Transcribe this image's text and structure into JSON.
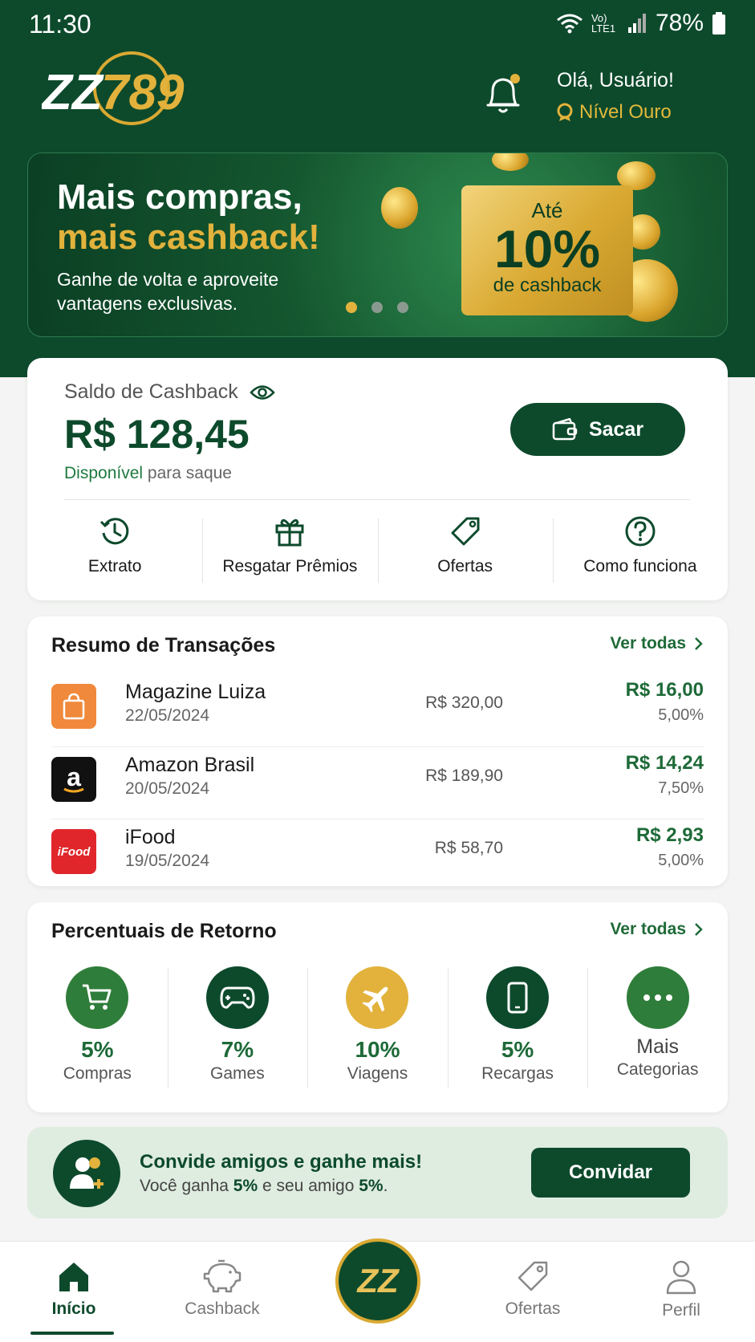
{
  "status": {
    "time": "11:30",
    "network": "Vo) LTE1",
    "battery": "78%"
  },
  "header": {
    "logo": "ZZ789",
    "greeting": "Olá, Usuário!",
    "level": "Nível Ouro"
  },
  "banner": {
    "title_line1": "Mais compras,",
    "title_line2": "mais cashback!",
    "subtitle": "Ganhe de volta e aproveite vantagens exclusivas.",
    "badge_top": "Até",
    "badge_value": "10%",
    "badge_bottom": "de cashback",
    "slides": 3,
    "active_slide": 1
  },
  "balance": {
    "label": "Saldo de Cashback",
    "value": "R$ 128,45",
    "available_word": "Disponível",
    "available_rest": "para saque",
    "withdraw_label": "Sacar",
    "actions": [
      {
        "label": "Extrato",
        "icon": "history-icon"
      },
      {
        "label": "Resgatar Prêmios",
        "icon": "gift-icon"
      },
      {
        "label": "Ofertas",
        "icon": "tag-icon"
      },
      {
        "label": "Como funciona",
        "icon": "help-icon"
      }
    ]
  },
  "transactions": {
    "title": "Resumo de Transações",
    "see_all": "Ver todas",
    "items": [
      {
        "name": "Magazine Luiza",
        "date": "22/05/2024",
        "amount": "R$ 320,00",
        "cashback": "R$ 16,00",
        "percent": "5,00%"
      },
      {
        "name": "Amazon Brasil",
        "date": "20/05/2024",
        "amount": "R$ 189,90",
        "cashback": "R$ 14,24",
        "percent": "7,50%"
      },
      {
        "name": "iFood",
        "date": "19/05/2024",
        "amount": "R$ 58,70",
        "cashback": "R$ 2,93",
        "percent": "5,00%"
      }
    ]
  },
  "returns": {
    "title": "Percentuais de Retorno",
    "see_all": "Ver todas",
    "categories": [
      {
        "percent": "5%",
        "label": "Compras",
        "color": "#2f7d3a"
      },
      {
        "percent": "7%",
        "label": "Games",
        "color": "#0d4a2c"
      },
      {
        "percent": "10%",
        "label": "Viagens",
        "color": "#e2b23c"
      },
      {
        "percent": "5%",
        "label": "Recargas",
        "color": "#0d4a2c"
      }
    ],
    "more_line1": "Mais",
    "more_line2": "Categorias"
  },
  "invite": {
    "title": "Convide amigos e ganhe mais!",
    "sub_prefix": "Você ganha",
    "sub_you": "5%",
    "sub_mid": "e seu amigo",
    "sub_friend": "5%",
    "sub_suffix": ".",
    "button": "Convidar"
  },
  "nav": {
    "items": [
      "Início",
      "Cashback",
      "Ofertas",
      "Perfil"
    ],
    "center": "ZZ"
  }
}
